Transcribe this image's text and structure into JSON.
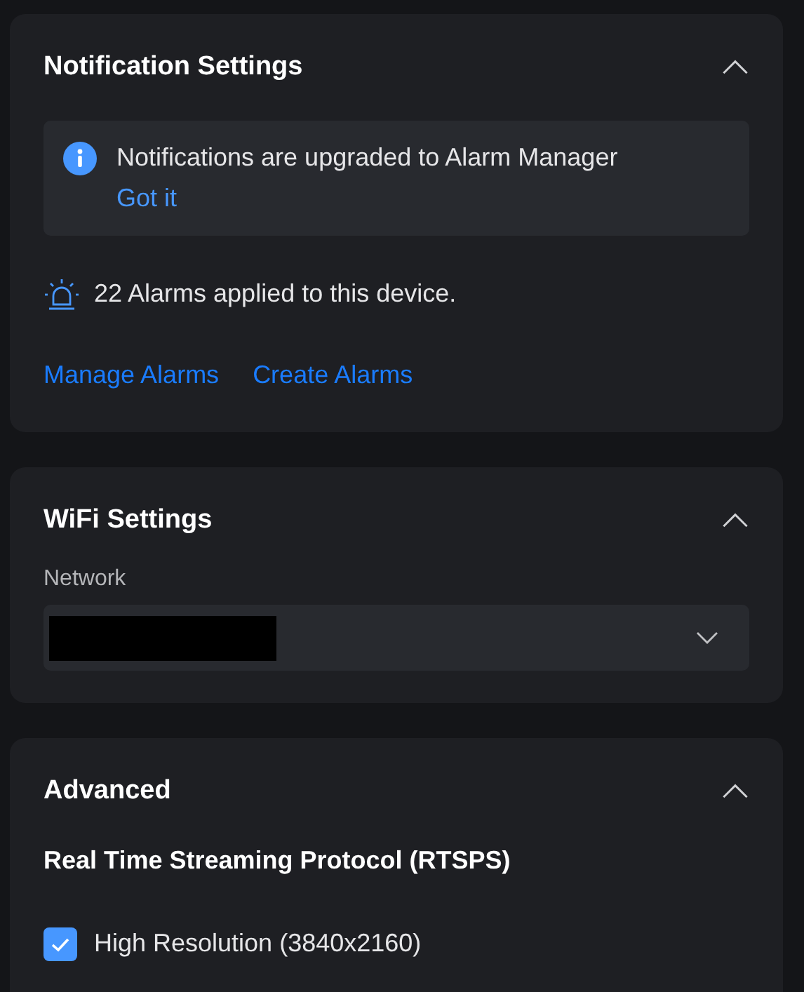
{
  "notification_settings": {
    "title": "Notification Settings",
    "expanded": true,
    "notice": {
      "message": "Notifications are upgraded to Alarm Manager",
      "action": "Got it"
    },
    "alarm_summary": "22 Alarms applied to this device.",
    "links": [
      "Manage Alarms",
      "Create Alarms"
    ]
  },
  "wifi_settings": {
    "title": "WiFi Settings",
    "expanded": true,
    "network": {
      "label": "Network",
      "value_redacted": true
    }
  },
  "advanced": {
    "title": "Advanced",
    "expanded": true,
    "subheading": "Real Time Streaming Protocol (RTSPS)",
    "options": [
      {
        "label": "High Resolution (3840x2160)",
        "checked": true
      }
    ]
  }
}
